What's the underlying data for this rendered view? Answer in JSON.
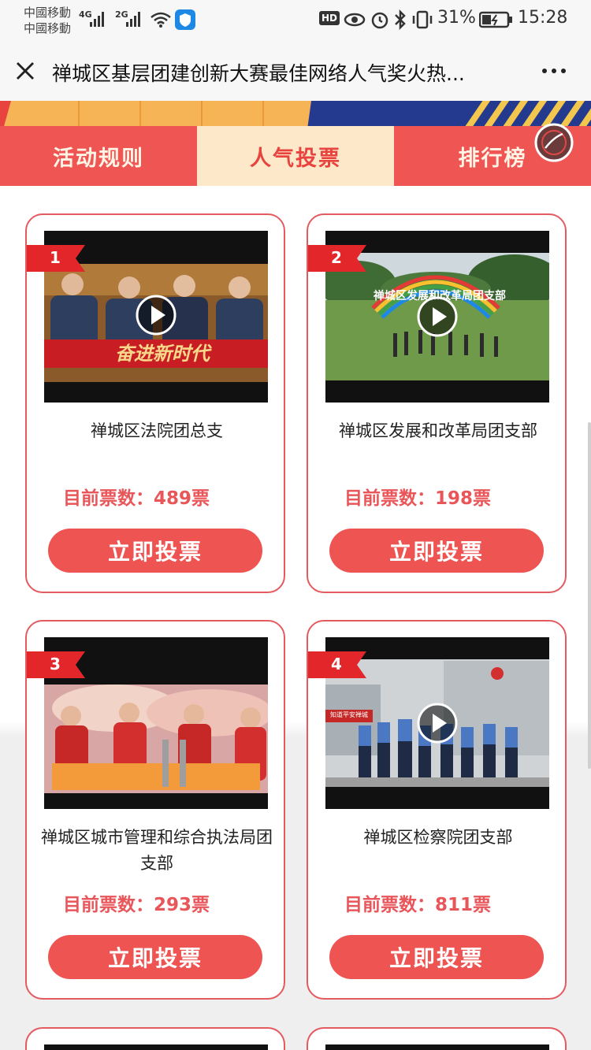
{
  "status_bar": {
    "carrier_1": "中國移動",
    "carrier_2": "中國移動",
    "network_1": "4G",
    "network_2": "2G",
    "hd_label": "HD",
    "battery_percent": "31%",
    "time": "15:28"
  },
  "title_bar": {
    "title": "禅城区基层团建创新大赛最佳网络人气奖火热..."
  },
  "tabs": [
    {
      "label": "活动规则",
      "active": false
    },
    {
      "label": "人气投票",
      "active": true
    },
    {
      "label": "排行榜",
      "active": false
    }
  ],
  "cards": [
    {
      "rank": "1",
      "name": "禅城区法院团总支",
      "votes_label": "目前票数：489票",
      "vote_button": "立即投票",
      "thumb_caption": "奋进新时代"
    },
    {
      "rank": "2",
      "name": "禅城区发展和改革局团支部",
      "votes_label": "目前票数：198票",
      "vote_button": "立即投票",
      "thumb_caption": "禅城区发展和改革局团支部"
    },
    {
      "rank": "3",
      "name": "禅城区城市管理和综合执法局团支部",
      "votes_label": "目前票数：293票",
      "vote_button": "立即投票"
    },
    {
      "rank": "4",
      "name": "禅城区检察院团支部",
      "votes_label": "目前票数：811票",
      "vote_button": "立即投票",
      "thumb_caption": "知道平安禅城"
    }
  ],
  "colors": {
    "accent_red": "#ee5452",
    "card_border": "#e35a5f",
    "tab_active_bg": "#fde9c9",
    "banner_orange": "#f5b04b"
  },
  "icons": [
    "close-icon",
    "more-icon",
    "music-icon",
    "play-icon",
    "wifi-icon",
    "eye-icon",
    "alarm-icon",
    "bluetooth-icon",
    "vibrate-icon",
    "battery-icon"
  ]
}
